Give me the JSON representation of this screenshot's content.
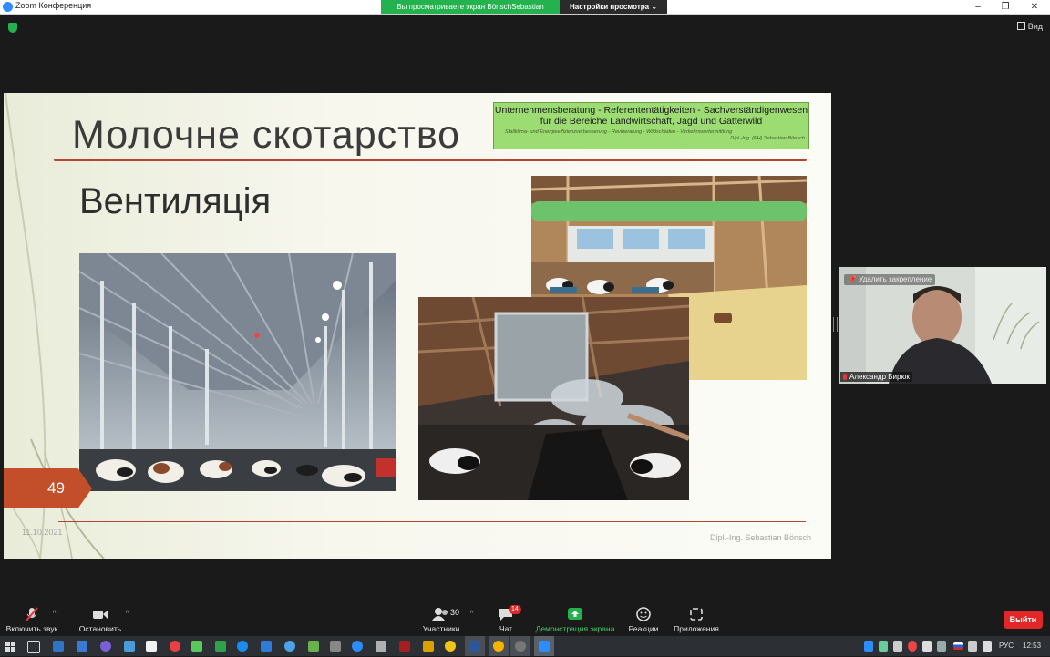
{
  "window": {
    "title": "Zoom Конференция",
    "minimize_glyph": "–",
    "restore_glyph": "❐",
    "close_glyph": "✕"
  },
  "share_banner": {
    "text": "Вы просматриваете экран BönschSebastian",
    "view_options": "Настройки просмотра ⌄"
  },
  "topbar": {
    "security_icon": "shield-icon",
    "view_label": "Вид"
  },
  "slide": {
    "title": "Молочне скотарство",
    "subtitle": "Вентиляція",
    "stamp": {
      "line1": "Unternehmensberatung  -  Referententätigkeiten  - Sachverständigenwesen",
      "line2": "für die Bereiche Landwirtschaft, Jagd und Gatterwild",
      "line3": "Stallklima- und Energieeffizienzverbesserung - Reviberatung - Wildschäden - Verkehrswertermittlung",
      "line4": "Dipl.-Ing. (FH) Sebastian Bönsch"
    },
    "slide_number": "49",
    "date": "11.10.2021",
    "author": "Dipl.-Ing. Sebastian Bönsch",
    "colors": {
      "accent": "#b5452f",
      "stamp_bg": "#9ddc73",
      "number_bg": "#c34e2a"
    }
  },
  "participant": {
    "unpin_label": "Удалить закрепление",
    "name": "Александр Бирюк"
  },
  "controls": {
    "mute_label": "Включить звук",
    "video_label": "Остановить видео",
    "participants_label": "Участники",
    "participants_count": "30",
    "chat_label": "Чат",
    "chat_badge": "14",
    "share_label": "Демонстрация экрана",
    "reactions_label": "Реакции",
    "apps_label": "Приложения",
    "leave_label": "Выйти"
  },
  "taskbar": {
    "language": "РУС",
    "time": "12:53"
  }
}
